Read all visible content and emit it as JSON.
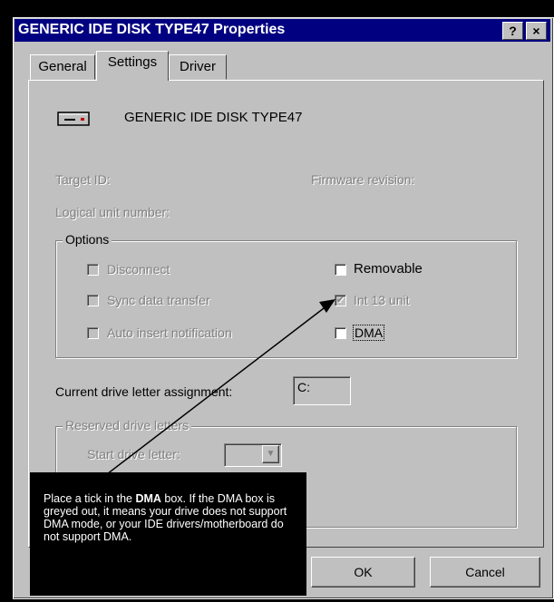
{
  "window": {
    "title": "GENERIC IDE  DISK TYPE47 Properties",
    "help_button": "?",
    "close_button": "×"
  },
  "tabs": [
    {
      "label": "General"
    },
    {
      "label": "Settings"
    },
    {
      "label": "Driver"
    }
  ],
  "device": {
    "name": "GENERIC IDE  DISK TYPE47",
    "icon": "disk-drive-icon"
  },
  "info": {
    "target_id_label": "Target ID:",
    "firmware_label": "Firmware revision:",
    "logical_unit_label": "Logical unit number:"
  },
  "options": {
    "title": "Options",
    "disconnect": {
      "label": "Disconnect",
      "checked": false,
      "enabled": false
    },
    "sync_data_transfer": {
      "label": "Sync data transfer",
      "checked": false,
      "enabled": false
    },
    "auto_insert": {
      "label": "Auto insert notification",
      "checked": false,
      "enabled": false
    },
    "removable": {
      "label": "Removable",
      "checked": false,
      "enabled": true
    },
    "int13": {
      "label": "Int 13 unit",
      "checked": true,
      "enabled": false
    },
    "dma": {
      "label": "DMA",
      "checked": false,
      "enabled": true
    }
  },
  "drive_letter": {
    "label": "Current drive letter assignment:",
    "value": "C:"
  },
  "reserved": {
    "title": "Reserved drive letters",
    "start_label": "Start drive letter:"
  },
  "buttons": {
    "ok": "OK",
    "cancel": "Cancel"
  },
  "callout": {
    "part1": "Place a tick in the ",
    "bold1": "DMA",
    "part2": " box.  If the DMA  box is greyed out, it means your drive does not support DMA mode, or your IDE drivers/motherboard do not support DMA."
  },
  "colors": {
    "title_bar": "#000080",
    "face": "#c0c0c0",
    "callout": "#000000"
  }
}
